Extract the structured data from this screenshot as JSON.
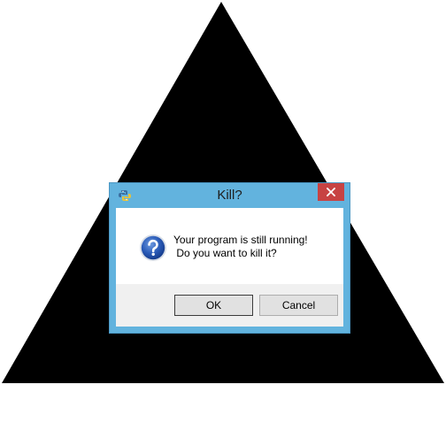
{
  "dialog": {
    "title": "Kill?",
    "message_line1": "Your program is still running!",
    "message_line2": " Do you want to kill it?",
    "ok_label": "OK",
    "cancel_label": "Cancel",
    "close_glyph": "✕",
    "app_icon": "python-icon",
    "message_icon": "question-icon"
  },
  "colors": {
    "background": "#ffffff",
    "triangle": "#000000",
    "titlebar": "#62b3de",
    "close_button": "#c74343",
    "button_panel": "#f0f0f0"
  }
}
